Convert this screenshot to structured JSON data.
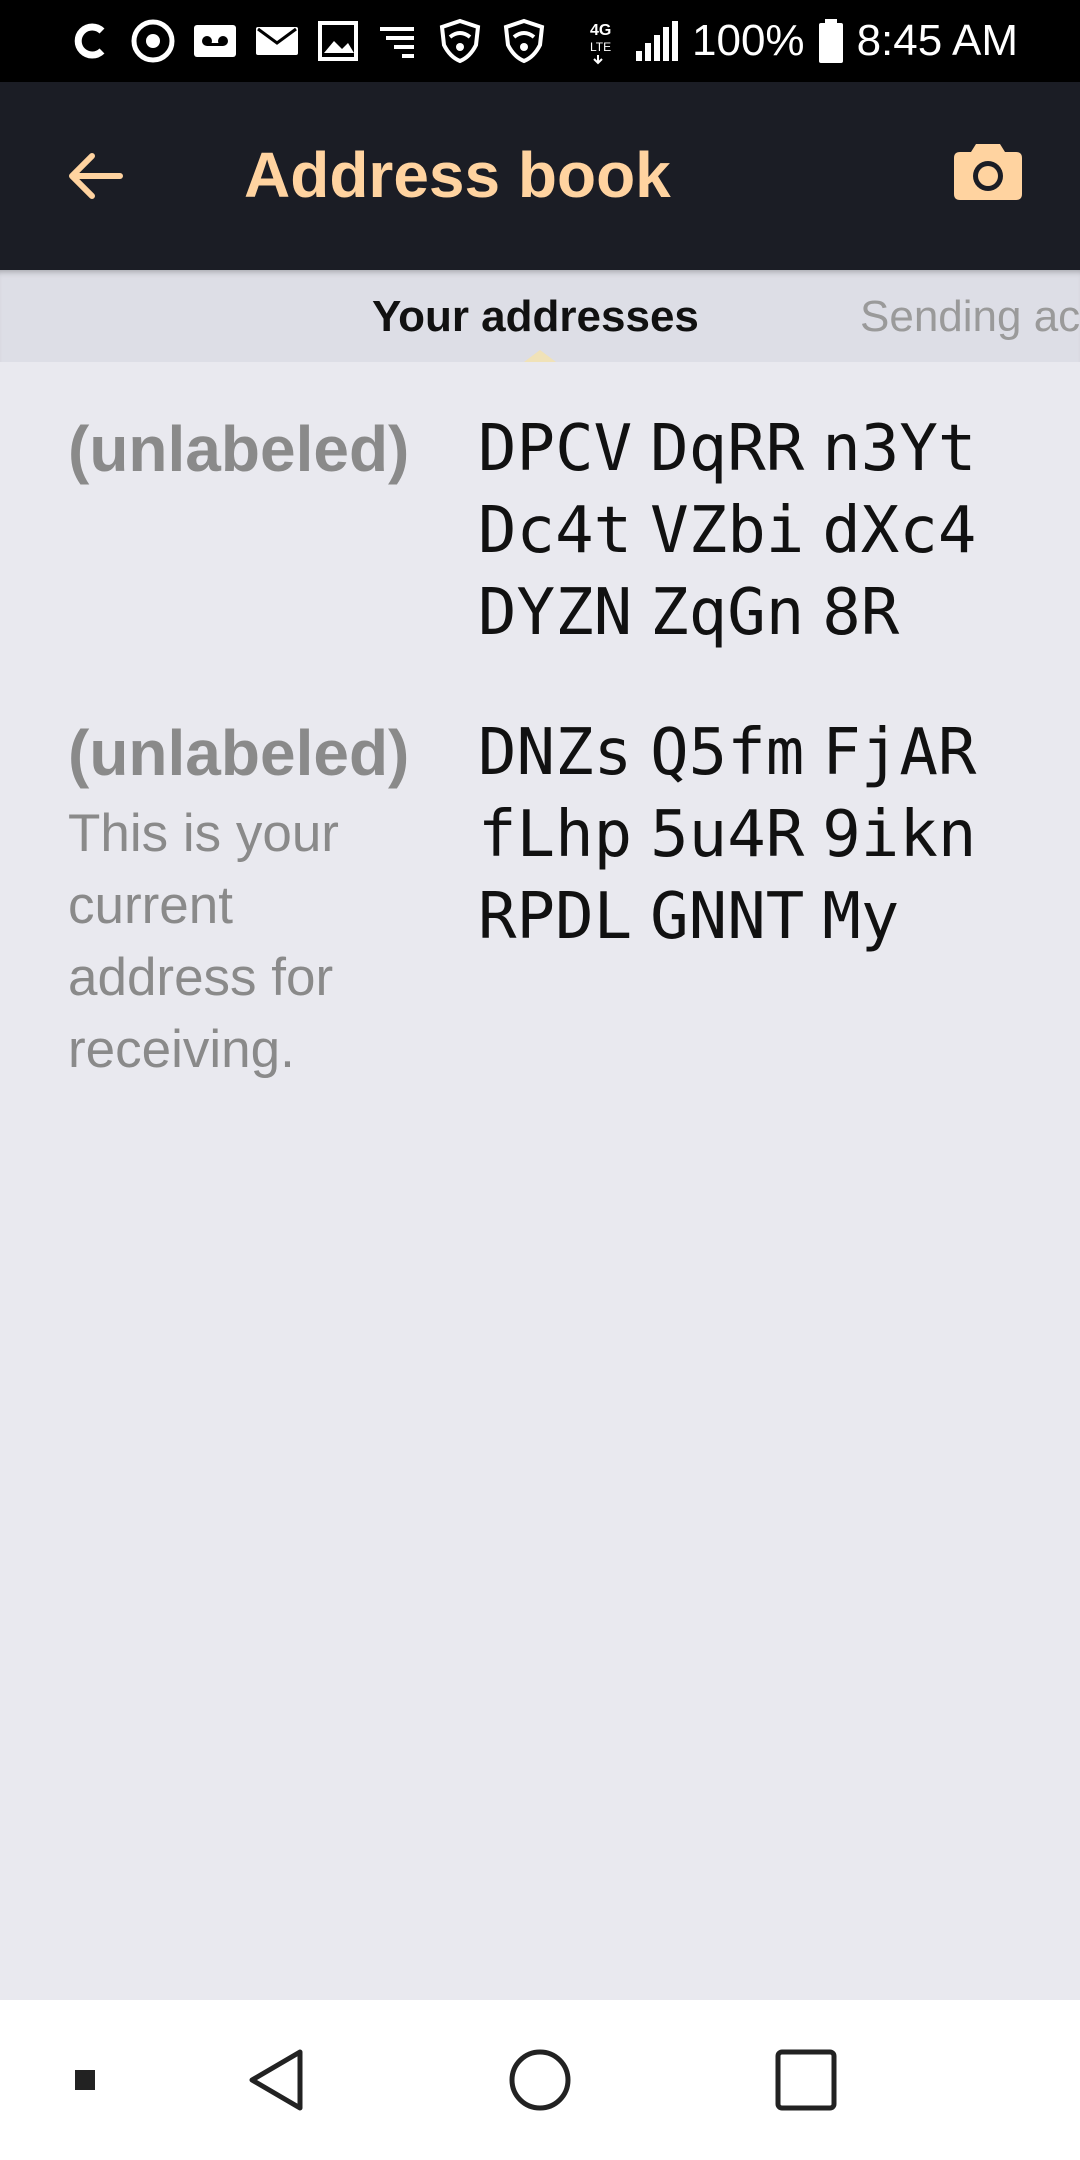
{
  "status_bar": {
    "battery": "100%",
    "time": "8:45 AM",
    "network": "4G LTE"
  },
  "app_bar": {
    "title": "Address book",
    "back_icon": "arrow-left-icon",
    "camera_icon": "camera-icon",
    "accent_color": "#ffd3a0",
    "background_color": "#1b1d25"
  },
  "tabs": [
    {
      "label": "Your addresses",
      "active": true
    },
    {
      "label": "Sending ac",
      "active": false
    }
  ],
  "addresses": [
    {
      "label": "(unlabeled)",
      "note": "",
      "address_lines": [
        [
          "DPCV",
          "DqRR",
          "n3Yt"
        ],
        [
          "Dc4t",
          "VZbi",
          "dXc4"
        ],
        [
          "DYZN",
          "ZqGn",
          "8R"
        ]
      ]
    },
    {
      "label": "(unlabeled)",
      "note": "This is your current address for receiving.",
      "address_lines": [
        [
          "DNZs",
          "Q5fm",
          "FjAR"
        ],
        [
          "fLhp",
          "5u4R",
          "9ikn"
        ],
        [
          "RPDL",
          "GNNT",
          "My"
        ]
      ]
    }
  ],
  "nav_bar": {
    "buttons": [
      "recent-dot-icon",
      "back-triangle-icon",
      "home-circle-icon",
      "overview-square-icon"
    ]
  }
}
